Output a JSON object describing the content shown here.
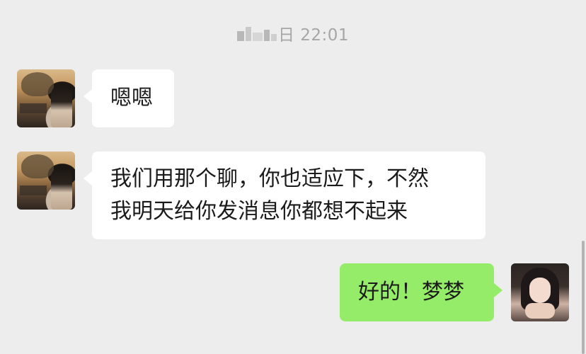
{
  "chat": {
    "timestamp": {
      "time_text": "日 22:01",
      "date_obscured": true
    },
    "messages": [
      {
        "sender": "contact",
        "lines": [
          "嗯嗯"
        ]
      },
      {
        "sender": "contact",
        "lines": [
          "我们用那个聊，你也适应下，不然",
          "我明天给你发消息你都想不起来"
        ]
      },
      {
        "sender": "self",
        "lines": [
          "好的！梦梦"
        ]
      }
    ]
  },
  "colors": {
    "background": "#ededed",
    "incoming_bubble": "#ffffff",
    "outgoing_bubble": "#95ec69",
    "timestamp_text": "#a6a6a6"
  },
  "icons": {
    "contact_avatar": "photo-avatar",
    "self_avatar": "photo-avatar"
  }
}
